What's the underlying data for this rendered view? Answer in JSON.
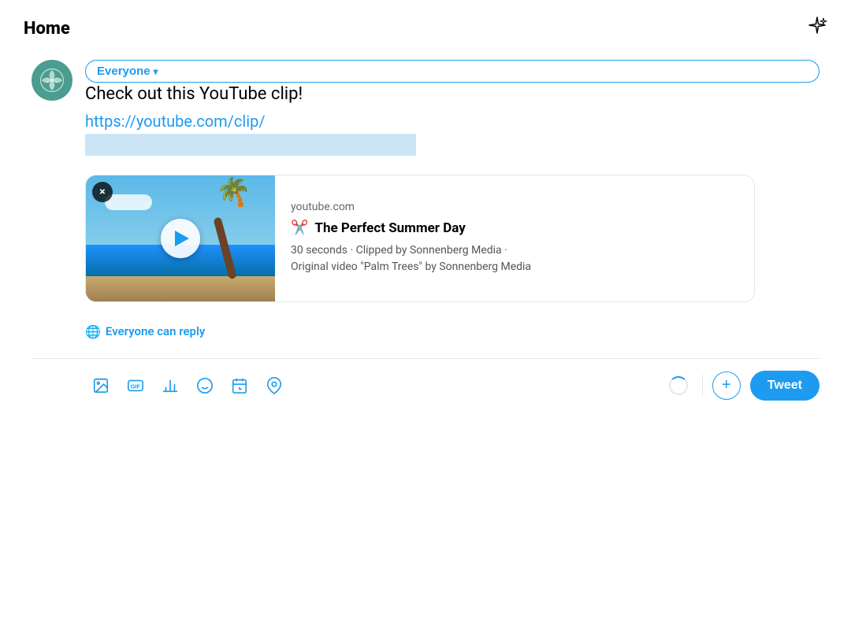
{
  "header": {
    "title": "Home",
    "sparkle_label": "✦"
  },
  "composer": {
    "everyone_label": "Everyone",
    "tweet_text": "Check out this YouTube clip!",
    "tweet_link": "https://youtube.com/clip/",
    "everyone_can_reply_label": "Everyone can reply"
  },
  "youtube_card": {
    "source": "youtube.com",
    "title": "The Perfect Summer Day",
    "meta_line1": "30 seconds · Clipped by Sonnenberg Media ·",
    "meta_line2": "Original video \"Palm Trees\" by Sonnenberg Media",
    "close_label": "×"
  },
  "toolbar": {
    "image_icon": "image",
    "gif_icon": "GIF",
    "poll_icon": "poll",
    "emoji_icon": "emoji",
    "schedule_icon": "schedule",
    "location_icon": "location",
    "plus_label": "+",
    "tweet_label": "Tweet"
  }
}
